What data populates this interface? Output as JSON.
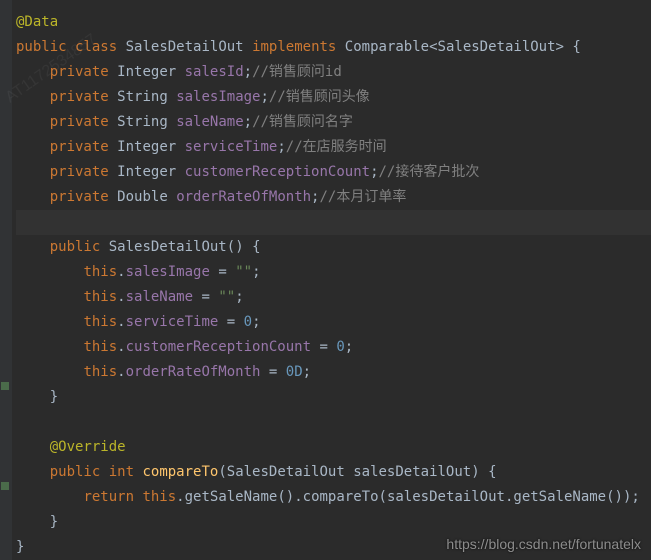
{
  "code": {
    "annotation": "@Data",
    "kw_public": "public",
    "kw_class": "class",
    "kw_implements": "implements",
    "kw_private": "private",
    "kw_int": "int",
    "kw_return": "return",
    "kw_this": "this",
    "class_name": "SalesDetailOut",
    "iface": "Comparable",
    "lt": "<",
    "gt": ">",
    "lbrace": "{",
    "rbrace": "}",
    "lparen": "(",
    "rparen": ")",
    "semi": ";",
    "dot": ".",
    "comma": ",",
    "eq": "=",
    "space": " ",
    "type_Integer": "Integer",
    "type_String": "String",
    "type_Double": "Double",
    "f_salesId": "salesId",
    "f_salesImage": "salesImage",
    "f_saleName": "saleName",
    "f_serviceTime": "serviceTime",
    "f_customerReceptionCount": "customerReceptionCount",
    "f_orderRateOfMonth": "orderRateOfMonth",
    "c_salesId": "//销售顾问id",
    "c_salesImage": "//销售顾问头像",
    "c_saleName": "//销售顾问名字",
    "c_serviceTime": "//在店服务时间",
    "c_customerReceptionCount": "//接待客户批次",
    "c_orderRateOfMonth": "//本月订单率",
    "str_empty": "\"\"",
    "num_zero": "0",
    "num_zeroD": "0D",
    "override": "@Override",
    "m_compareTo": "compareTo",
    "p_name": "salesDetailOut",
    "m_getSaleName": "getSaleName"
  },
  "watermark": "https://blog.csdn.net/fortunatelx",
  "side_watermark": "AT1172534857"
}
